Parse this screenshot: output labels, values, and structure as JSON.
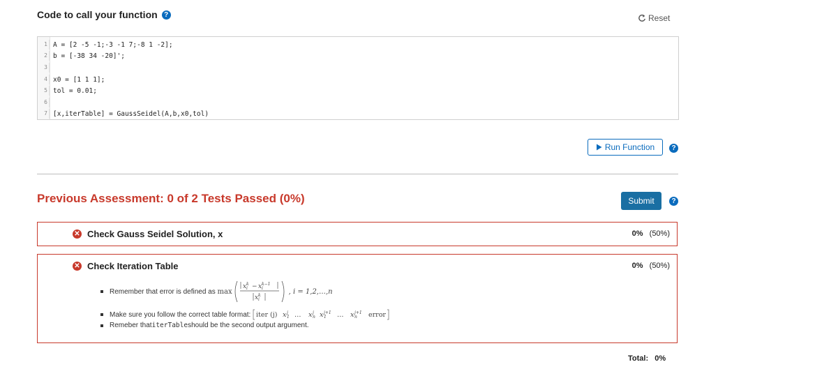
{
  "header": {
    "title": "Code to call your function",
    "reset_label": "Reset"
  },
  "editor": {
    "lines": [
      {
        "num": "1",
        "code": "A = [2 -5 -1;-3 -1 7;-8 1 -2];"
      },
      {
        "num": "2",
        "code": "b = [-38 34 -20]';"
      },
      {
        "num": "3",
        "code": ""
      },
      {
        "num": "4",
        "code": "x0 = [1 1 1];"
      },
      {
        "num": "5",
        "code": "tol = 0.01;"
      },
      {
        "num": "6",
        "code": ""
      },
      {
        "num": "7",
        "code": "[x,iterTable] = GaussSeidel(A,b,x0,tol)"
      }
    ]
  },
  "run": {
    "label": "Run Function"
  },
  "assessment": {
    "title": "Previous Assessment: 0 of 2 Tests Passed (0%)",
    "submit_label": "Submit",
    "tests": [
      {
        "name": "Check Gauss Seidel Solution, x",
        "score": "0%",
        "weight": "(50%)"
      },
      {
        "name": "Check Iteration Table",
        "score": "0%",
        "weight": "(50%)"
      }
    ],
    "notes": {
      "error_text": "Remember that error is defined as",
      "error_formula": "max",
      "error_range": "i = 1,2,…,n",
      "format_text": "Make sure you follow the correct table format:",
      "format_cols": "iter (j)   x",
      "reminder_prefix": "Remeber that ",
      "reminder_code": "iterTable",
      "reminder_suffix": " should be the second output argument."
    },
    "total_label": "Total:",
    "total_value": "0%"
  },
  "colors": {
    "accent": "#0a6bbd",
    "fail": "#c8392b",
    "submit": "#1a6fa3"
  }
}
